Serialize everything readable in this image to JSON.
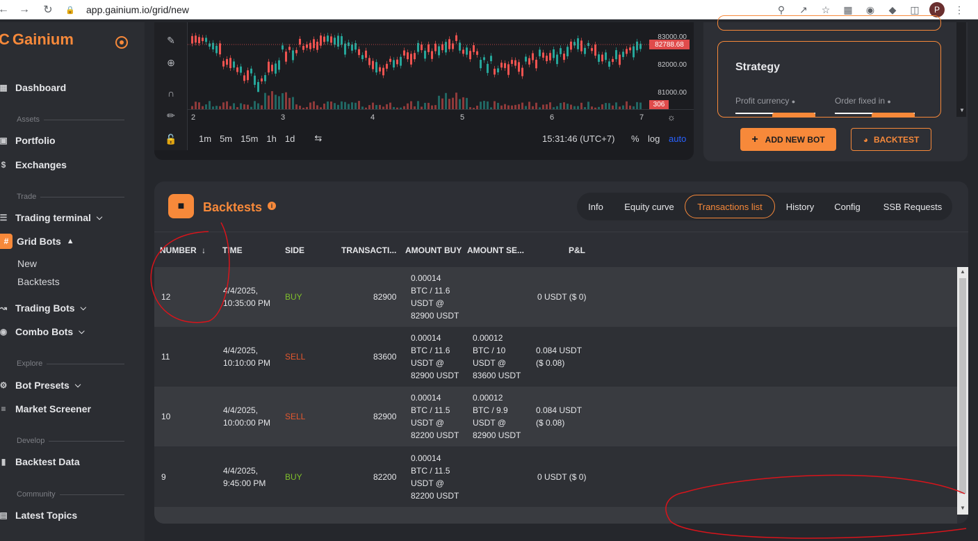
{
  "browser": {
    "url": "app.gainium.io/grid/new",
    "profile_initial": "P"
  },
  "sidebar": {
    "brand": "Gainium",
    "dashboard": "Dashboard",
    "sections": {
      "assets": "Assets",
      "trade": "Trade",
      "explore": "Explore",
      "develop": "Develop",
      "community": "Community"
    },
    "items": {
      "portfolio": "Portfolio",
      "exchanges": "Exchanges",
      "trading_terminal": "Trading terminal",
      "grid_bots": "Grid Bots",
      "new": "New",
      "backtests": "Backtests",
      "trading_bots": "Trading Bots",
      "combo_bots": "Combo Bots",
      "bot_presets": "Bot Presets",
      "market_screener": "Market Screener",
      "backtest_data": "Backtest Data",
      "latest_topics": "Latest Topics"
    }
  },
  "chart": {
    "prices": [
      "83000.00",
      "82000.00",
      "81000.00"
    ],
    "current_price": "82788.68",
    "volume_tag": "306",
    "dates": [
      "2",
      "3",
      "4",
      "5",
      "6",
      "7"
    ],
    "intervals": [
      "1m",
      "5m",
      "15m",
      "1h",
      "1d"
    ],
    "clock": "15:31:46 (UTC+7)",
    "percent": "%",
    "log": "log",
    "auto": "auto",
    "colors": {
      "up": "#26a69a",
      "down": "#ef5350",
      "auto": "#2962ff"
    }
  },
  "strategy": {
    "title": "Strategy",
    "profit_currency": "Profit currency",
    "order_fixed_in": "Order fixed in",
    "add_new_bot": "ADD NEW BOT",
    "backtest": "BACKTEST"
  },
  "backtests": {
    "title": "Backtests",
    "tabs": [
      {
        "label": "Info",
        "active": false
      },
      {
        "label": "Equity curve",
        "active": false
      },
      {
        "label": "Transactions list",
        "active": true
      },
      {
        "label": "History",
        "active": false
      },
      {
        "label": "Config",
        "active": false
      },
      {
        "label": "SSB Requests",
        "active": false
      }
    ],
    "columns": [
      "NUMBER",
      "TIME",
      "SIDE",
      "TRANSACTI...",
      "AMOUNT BUY",
      "AMOUNT SE...",
      "P&L"
    ],
    "rows": [
      {
        "number": "12",
        "time1": "4/4/2025,",
        "time2": "10:35:00 PM",
        "side": "BUY",
        "tx": "82900",
        "buy": [
          "0.00014",
          "BTC / 11.6",
          "USDT @",
          "82900 USDT"
        ],
        "sell": [
          "",
          "",
          "",
          ""
        ],
        "pnl1": "0 USDT ($ 0)",
        "pnl2": ""
      },
      {
        "number": "11",
        "time1": "4/4/2025,",
        "time2": "10:10:00 PM",
        "side": "SELL",
        "tx": "83600",
        "buy": [
          "0.00014",
          "BTC / 11.6",
          "USDT @",
          "82900 USDT"
        ],
        "sell": [
          "0.00012",
          "BTC / 10",
          "USDT @",
          "83600 USDT"
        ],
        "pnl1": "0.084 USDT",
        "pnl2": "($ 0.08)"
      },
      {
        "number": "10",
        "time1": "4/4/2025,",
        "time2": "10:00:00 PM",
        "side": "SELL",
        "tx": "82900",
        "buy": [
          "0.00014",
          "BTC / 11.5",
          "USDT @",
          "82200 USDT"
        ],
        "sell": [
          "0.00012",
          "BTC / 9.9",
          "USDT @",
          "82900 USDT"
        ],
        "pnl1": "0.084 USDT",
        "pnl2": "($ 0.08)"
      },
      {
        "number": "9",
        "time1": "4/4/2025,",
        "time2": "9:45:00 PM",
        "side": "BUY",
        "tx": "82200",
        "buy": [
          "0.00014",
          "BTC / 11.5",
          "USDT @",
          "82200 USDT"
        ],
        "sell": [
          "",
          "",
          "",
          ""
        ],
        "pnl1": "0 USDT ($ 0)",
        "pnl2": ""
      }
    ]
  },
  "colors": {
    "accent": "#f7893a",
    "buy": "#7fbf2b",
    "sell": "#e4572e",
    "annotation": "#d9141b"
  }
}
